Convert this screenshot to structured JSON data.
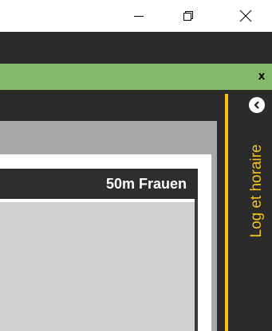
{
  "window": {
    "minimize_icon": "minimize-icon",
    "restore_icon": "restore-icon",
    "close_icon": "close-icon"
  },
  "banner": {
    "close_label": "x",
    "color": "#83b96b"
  },
  "panel": {
    "title": "50m Frauen"
  },
  "side_panel": {
    "label": "Log et horaire",
    "accent_color": "#f4c21b",
    "collapse_icon": "chevron-left-icon"
  }
}
